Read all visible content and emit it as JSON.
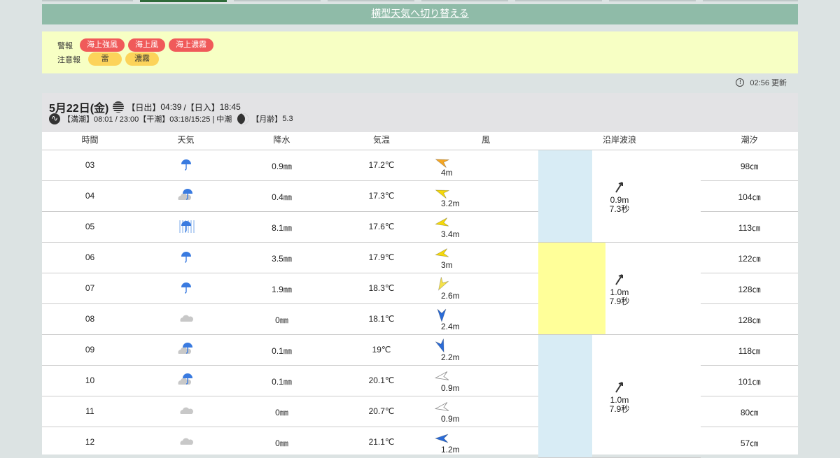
{
  "nav": {
    "toggle_label": "横型天気へ切り替える"
  },
  "alerts": {
    "warning_label": "警報",
    "warnings": [
      "海上強風",
      "海上風",
      "海上濃霧"
    ],
    "advisory_label": "注意報",
    "advisories": [
      "雷",
      "濃霧"
    ]
  },
  "update": {
    "text": "02:56 更新"
  },
  "day": {
    "date": "5月22日(金)",
    "sunrise_label": "【日出】",
    "sunrise": "04:39",
    "sunset_label": "/【日入】",
    "sunset": "18:45",
    "tide_info": "【満潮】08:01 / 23:00【干潮】03:18/15:25 | 中潮",
    "moon_label": "【月齢】",
    "moon_age": "5.3"
  },
  "columns": {
    "time": "時間",
    "weather": "天気",
    "precip": "降水",
    "temp": "気温",
    "wind": "風",
    "wave": "沿岸波浪",
    "tide": "潮汐"
  },
  "rows": [
    {
      "time": "03",
      "weather": "rain-icon",
      "precip": "0.9㎜",
      "temp": "17.2℃",
      "wind_speed": "4m",
      "wind_color": "#f5a623",
      "wind_dir_deg": 200,
      "tide": "98㎝"
    },
    {
      "time": "04",
      "weather": "cloud-rain-icon",
      "precip": "0.4㎜",
      "temp": "17.3℃",
      "wind_speed": "3.2m",
      "wind_color": "#f5d90a",
      "wind_dir_deg": 200,
      "tide": "104㎝"
    },
    {
      "time": "05",
      "weather": "heavy-rain-icon",
      "precip": "8.1㎜",
      "temp": "17.6℃",
      "wind_speed": "3.4m",
      "wind_color": "#f5d90a",
      "wind_dir_deg": 170,
      "tide": "113㎝"
    },
    {
      "time": "06",
      "weather": "rain-icon",
      "precip": "3.5㎜",
      "temp": "17.9℃",
      "wind_speed": "3m",
      "wind_color": "#f5d90a",
      "wind_dir_deg": 170,
      "tide": "122㎝"
    },
    {
      "time": "07",
      "weather": "rain-icon",
      "precip": "1.9㎜",
      "temp": "18.3℃",
      "wind_speed": "2.6m",
      "wind_color": "#f5e24a",
      "wind_dir_deg": 120,
      "tide": "128㎝"
    },
    {
      "time": "08",
      "weather": "cloud-icon",
      "precip": "0㎜",
      "temp": "18.1℃",
      "wind_speed": "2.4m",
      "wind_color": "#2a6bd8",
      "wind_dir_deg": 90,
      "tide": "128㎝"
    },
    {
      "time": "09",
      "weather": "cloud-rain-icon",
      "precip": "0.1㎜",
      "temp": "19℃",
      "wind_speed": "2.2m",
      "wind_color": "#2a6bd8",
      "wind_dir_deg": 70,
      "tide": "118㎝"
    },
    {
      "time": "10",
      "weather": "cloud-rain-icon",
      "precip": "0.1㎜",
      "temp": "20.1℃",
      "wind_speed": "0.9m",
      "wind_color": "#ffffff",
      "wind_dir_deg": 170,
      "tide": "101㎝"
    },
    {
      "time": "11",
      "weather": "cloud-icon",
      "precip": "0㎜",
      "temp": "20.7℃",
      "wind_speed": "0.9m",
      "wind_color": "#ffffff",
      "wind_dir_deg": 170,
      "tide": "80㎝"
    },
    {
      "time": "12",
      "weather": "cloud-icon",
      "precip": "0㎜",
      "temp": "21.1℃",
      "wind_speed": "1.2m",
      "wind_color": "#2a6bd8",
      "wind_dir_deg": 180,
      "tide": "57㎝"
    }
  ],
  "waves": [
    {
      "height": "0.9m",
      "period": "7.3秒",
      "bg": "#d8ecf5",
      "rows": 3
    },
    {
      "height": "1.0m",
      "period": "7.9秒",
      "bg": "#ffff99",
      "rows": 3
    },
    {
      "height": "1.0m",
      "period": "7.9秒",
      "bg": "#d8ecf5",
      "rows": 4
    }
  ]
}
